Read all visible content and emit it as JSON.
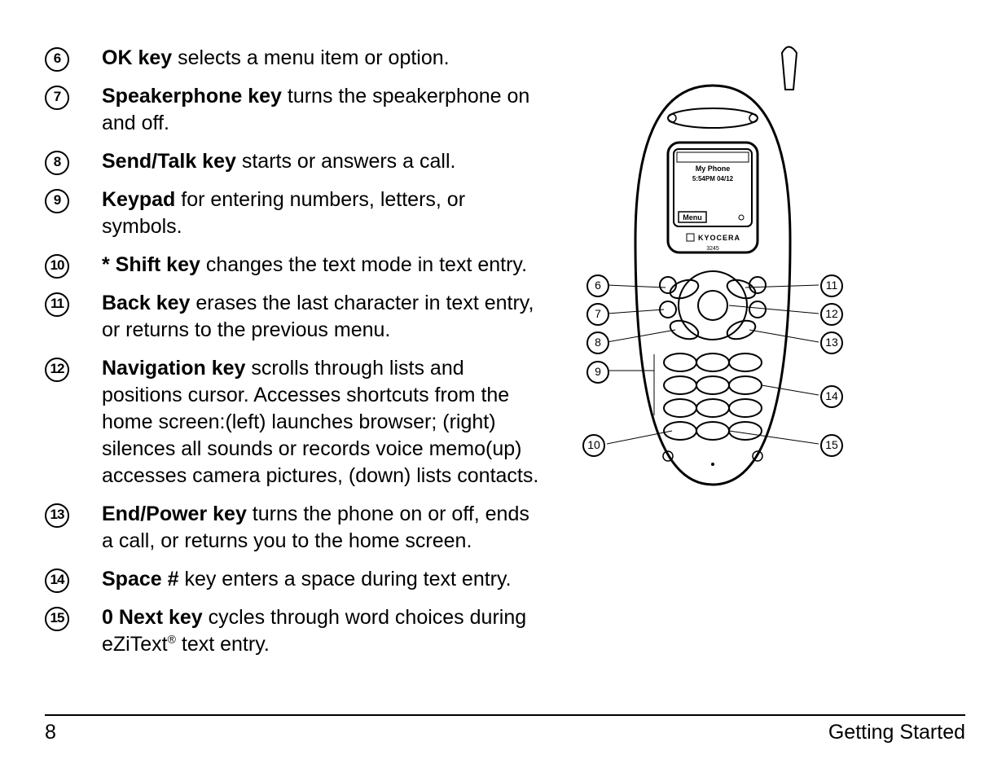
{
  "items": [
    {
      "n": "6",
      "bold": "OK key",
      "rest": " selects a menu item or option."
    },
    {
      "n": "7",
      "bold": "Speakerphone key",
      "rest": " turns the speakerphone on and off."
    },
    {
      "n": "8",
      "bold": "Send/Talk key",
      "rest": " starts or answers a call."
    },
    {
      "n": "9",
      "bold": "Keypad",
      "rest": " for entering numbers, letters, or symbols."
    },
    {
      "n": "10",
      "bold": "* Shift key",
      "rest": " changes the text mode in text entry."
    },
    {
      "n": "11",
      "bold": "Back key",
      "rest": " erases the last character in text entry, or returns to the previous menu."
    },
    {
      "n": "12",
      "bold": "Navigation key",
      "rest": " scrolls through lists and positions cursor. Accesses shortcuts from the home screen:(left) launches browser; (right) silences all sounds or records voice memo(up) accesses camera pictures, (down) lists contacts."
    },
    {
      "n": "13",
      "bold": "End/Power key",
      "rest": " turns the phone on or off, ends a call, or returns you to the home screen."
    },
    {
      "n": "14",
      "bold": "Space #",
      "rest": " key enters a space during text entry."
    },
    {
      "n": "15",
      "bold": "0 Next key",
      "rest": " cycles through word choices during eZiText"
    }
  ],
  "registered_tail": " text entry.",
  "registered": "®",
  "footer": {
    "page": "8",
    "section": "Getting Started"
  },
  "phone_screen": {
    "line1": "My Phone",
    "line2": "5:54PM   04/12",
    "menu": "Menu",
    "brand": "KYOCERA",
    "model": "3245"
  },
  "callouts_left": [
    "6",
    "7",
    "8",
    "9",
    "10"
  ],
  "callouts_right": [
    "11",
    "12",
    "13",
    "14",
    "15"
  ]
}
